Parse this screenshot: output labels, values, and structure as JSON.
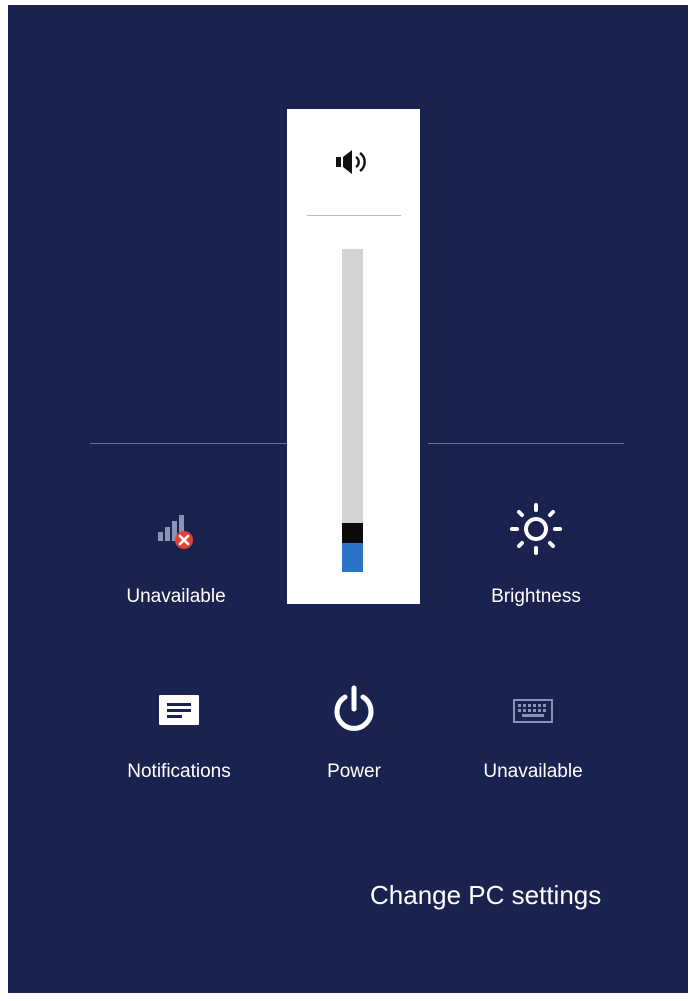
{
  "network": {
    "label": "Unavailable",
    "icon": "network-unavailable-icon"
  },
  "brightness": {
    "label": "Brightness",
    "icon": "brightness-sun-icon"
  },
  "notifications": {
    "label": "Notifications",
    "icon": "notifications-icon"
  },
  "power": {
    "label": "Power",
    "icon": "power-icon"
  },
  "keyboard": {
    "label": "Unavailable",
    "icon": "keyboard-icon"
  },
  "volume": {
    "icon": "speaker-volume-icon",
    "level_percent": 9
  },
  "footer": {
    "change_settings_label": "Change PC settings"
  },
  "colors": {
    "background": "#1a2350",
    "flyout": "#ffffff",
    "slider_track": "#d3d3d3",
    "slider_fill": "#2b73c8",
    "slider_thumb": "#0b0b0b",
    "error_badge": "#e2413a"
  }
}
